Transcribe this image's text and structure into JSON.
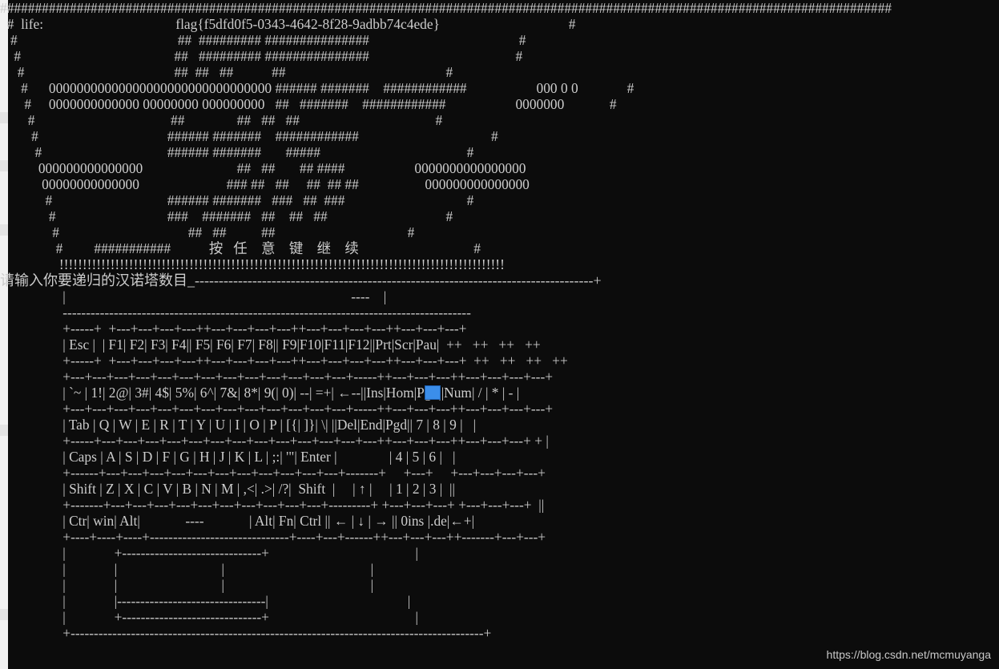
{
  "console": {
    "lines": [
      "################################################################################################################################",
      "  #  life:                                      flag{f5dfd0f5-0343-4642-8f28-9adbb74c4ede}                                     #",
      "   #                                              ##  ######### ###############                                           #",
      "    #                                            ##   ######### ###############                                          #",
      "     #                                           ##  ##   ##           ##                                              #",
      "      #      00000000000000000000000000000000 ###### #######    ############                    000 0 0              #",
      "       #     0000000000000 00000000 000000000   ##   #######    ############                    0000000             #",
      "        #                                       ##               ##   ##   ##                                       #",
      "         #                                     ###### #######    ############                                      #",
      "          #                                    ###### #######       #####                                          #",
      "           000000000000000                           ##   ##       ## ####                    0000000000000000",
      "            00000000000000                         ### ##   ##     ##  ## ##                   000000000000000",
      "             #                                 ###### #######   ###   ##  ###                                   #",
      "              #                                ###    #######   ##    ##   ##                                  #",
      "               #                                     ##   ##          ##                                      #",
      "                #         ###########           按   任    意    键    继    续                                 #",
      "                 !!!!!!!!!!!!!!!!!!!!!!!!!!!!!!!!!!!!!!!!!!!!!!!!!!!!!!!!!!!!!!!!!!!!!!!!!!!!!!!!!!!!!!!!!!!!!!!!",
      "请输入你要递归的汉诺塔数目_-----------------------------------------------------------------------------------+",
      "                  |                                                                                  ----    |",
      "                  ----------------------------------------------------------------------------------------",
      "                  +-----+  +---+---+---+---++---+---+---+---++---+---+---+---++---+---+---+",
      "                  | Esc |  | F1| F2| F3| F4|| F5| F6| F7| F8|| F9|F10|F11|F12||Prt|Scr|Pau|  ++   ++   ++   ++",
      "                  +-----+  +---+---+---+---++---+---+---+---++---+---+---+---++---+---+---+  ++   ++   ++   ++",
      "                  +---+---+---+---+---+---+---+---+---+---+---+---+---+-----++---+---+---++---+---+---+---+",
      "                  | `~ | 1!| 2@| 3#| 4$| 5%| 6^| 7&| 8*| 9(| 0)| --| =+| ←--||Ins|Hom|Pgu||Num| / | * | - |",
      "                  +---+---+---+---+---+---+---+---+---+---+---+---+---+-----++---+---+---++---+---+---+---+",
      "                  | Tab | Q | W | E | R | T | Y | U | I | O | P | [{| ]}| \\| ||Del|End|Pgd|| 7 | 8 | 9 |   |",
      "                  +-----+---+---+---+---+---+---+---+---+---+---+---+---+---++---+---+---++---+---+---+ + |",
      "                  | Caps | A | S | D | F | G | H | J | K | L | ;:| '\"| Enter |               | 4 | 5 | 6 |   |",
      "                  +------+---+---+---+---+---+---+---+---+---+---+---+-------+     +---+     +---+---+---+---+",
      "                  | Shift | Z | X | C | V | B | N | M | ,<| .>| /?|  Shift  |     | ↑ |     | 1 | 2 | 3 |  ||",
      "                  +-------+---+---+---+---+---+---+---+---+---+---+---------+ +---+---+---+ +---+---+---+  ||",
      "                  | Ctr| win| Alt|             ----             | Alt| Fn| Ctrl || ← | ↓ | → || 0ins |.de|←+|",
      "                  +----+----+----+------------------------------+----+---+------++---+---+---++-------+---+---+",
      "                  |              +------------------------------+                                          |",
      "                  |              |                              |                                          |",
      "                  |              |                              |                                          |",
      "                  |              |--------------------------------|                                        |",
      "                  |              +------------------------------+                                          |",
      "                  +-----------------------------------------------------------------------------------------+"
    ],
    "line_offsets": [
      0,
      0,
      0,
      0,
      0,
      0,
      0,
      0,
      0,
      0,
      0,
      0,
      0,
      0,
      0,
      0,
      0,
      0,
      0,
      0,
      0,
      0,
      0,
      0,
      0,
      0,
      0,
      0,
      0,
      0,
      0,
      0,
      0,
      0,
      0,
      0,
      0,
      0,
      0,
      0
    ]
  },
  "watermark": "https://blog.csdn.net/mcmuyanga"
}
